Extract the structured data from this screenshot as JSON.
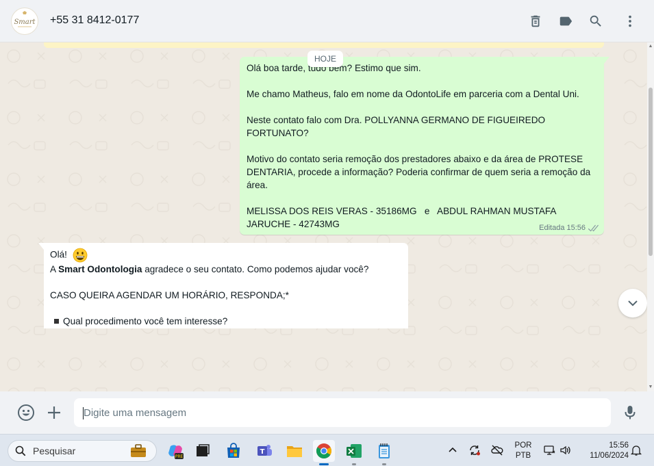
{
  "header": {
    "contact": "+55 31 8412-0177",
    "avatar_logo_text": "Smart",
    "icons": [
      "delete-icon",
      "label-icon",
      "search-icon",
      "more-icon"
    ]
  },
  "chat": {
    "date_divider": "HOJE",
    "outgoing": {
      "text": "Olá boa tarde, tudo bem? Estimo que sim.\n\nMe chamo Matheus, falo em nome da OdontoLife em parceria com a Dental Uni.\n\nNeste contato falo com Dra. POLLYANNA GERMANO DE FIGUEIREDO FORTUNATO?\n\nMotivo do contato seria remoção dos prestadores abaixo e da área de PROTESE DENTARIA, procede a informação? Poderia confirmar de quem seria a remoção da área.\n\nMELISSA DOS REIS VERAS - 35186MG   e   ABDUL RAHMAN MUSTAFA JARUCHE - 42743MG",
      "edited": "Editada",
      "time": "15:56"
    },
    "incoming": {
      "greeting": "Olá!",
      "line1_pre": "A ",
      "line1_bold": "Smart Odontologia",
      "line1_post": " agradece o seu contato. Como podemos ajudar você?",
      "line2": "CASO QUEIRA AGENDAR UM HORÁRIO, RESPONDA;*",
      "line3": "Qual procedimento você tem interesse?"
    }
  },
  "composer": {
    "placeholder": "Digite uma mensagem"
  },
  "taskbar": {
    "search_label": "Pesquisar",
    "lang_top": "POR",
    "lang_bottom": "PTB",
    "time": "15:56",
    "date": "11/06/2024"
  },
  "colors": {
    "outgoing_bubble": "#d9fdd3",
    "incoming_bubble": "#ffffff",
    "chat_bg": "#efeae2",
    "header_bg": "#f0f2f5"
  }
}
